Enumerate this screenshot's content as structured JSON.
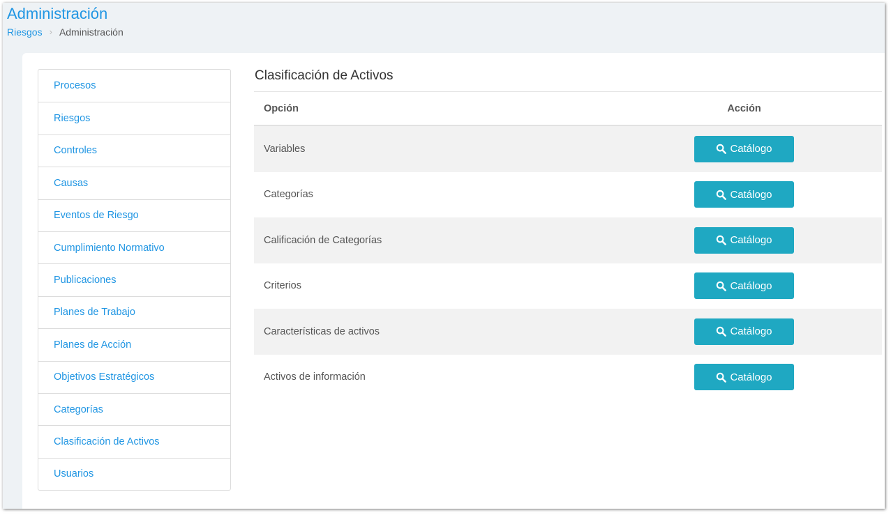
{
  "header": {
    "title": "Administración",
    "breadcrumb": [
      "Riesgos",
      "Administración"
    ]
  },
  "sidebar": {
    "items": [
      "Procesos",
      "Riesgos",
      "Controles",
      "Causas",
      "Eventos de Riesgo",
      "Cumplimiento Normativo",
      "Publicaciones",
      "Planes de Trabajo",
      "Planes de Acción",
      "Objetivos Estratégicos",
      "Categorías",
      "Clasificación de Activos",
      "Usuarios"
    ]
  },
  "main": {
    "title": "Clasificación de Activos",
    "columns": {
      "option": "Opción",
      "action": "Acción"
    },
    "rows": [
      {
        "option": "Variables",
        "button": "Catálogo"
      },
      {
        "option": "Categorías",
        "button": "Catálogo"
      },
      {
        "option": "Calificación de Categorías",
        "button": "Catálogo"
      },
      {
        "option": "Criterios",
        "button": "Catálogo"
      },
      {
        "option": "Características de activos",
        "button": "Catálogo"
      },
      {
        "option": "Activos de información",
        "button": "Catálogo"
      }
    ]
  },
  "icons": {
    "button_icon": "search-icon",
    "breadcrumb_separator": "chevron-right-icon"
  },
  "colors": {
    "accent": "#2196e3",
    "button": "#1fa8c2",
    "row_stripe": "#f2f2f2"
  }
}
